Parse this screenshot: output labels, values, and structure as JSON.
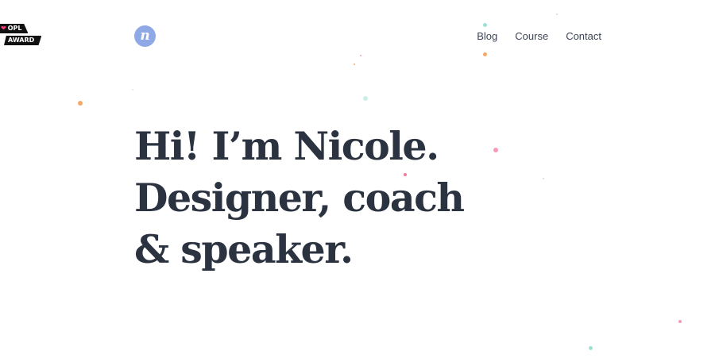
{
  "badge": {
    "line1": "OPL",
    "line2": "AWARD",
    "heart_color": "#ff3d7f"
  },
  "logo": {
    "letter": "n",
    "color": "#8fa8e6"
  },
  "nav": {
    "items": [
      {
        "label": "Blog"
      },
      {
        "label": "Course"
      },
      {
        "label": "Contact"
      }
    ]
  },
  "hero": {
    "line1": "Hi! I’m Nicole.",
    "line2": "Designer, coach",
    "line3": "& speaker."
  },
  "colors": {
    "text": "#2b3240",
    "orange": "#f4a96a",
    "teal": "#9ee0d2",
    "pink": "#f59ab3"
  }
}
